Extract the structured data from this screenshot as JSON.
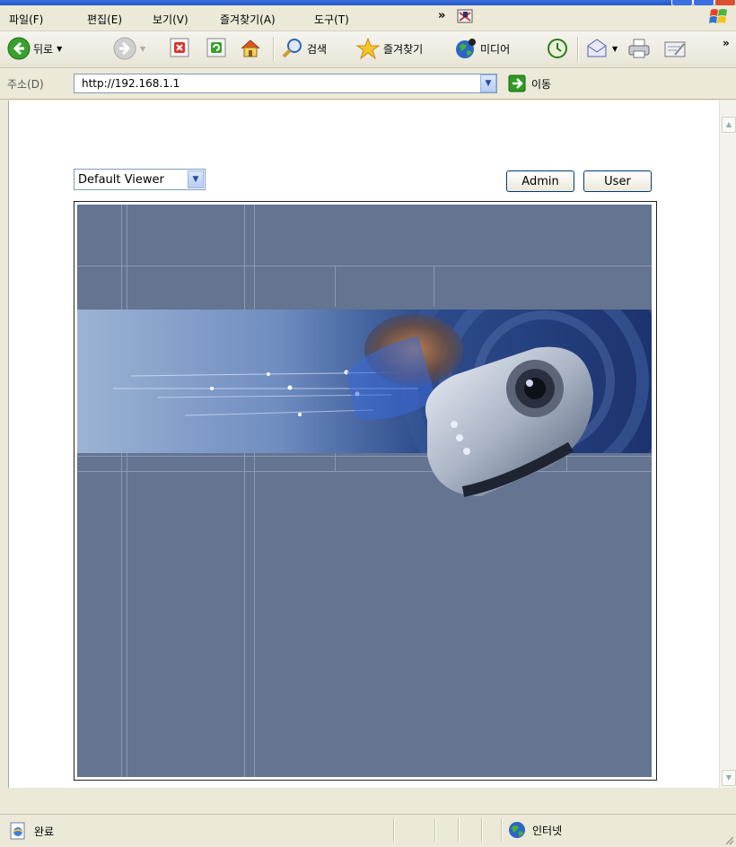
{
  "menu": {
    "items": [
      "파일(F)",
      "편집(E)",
      "보기(V)",
      "즐겨찾기(A)",
      "도구(T)"
    ],
    "more": "»"
  },
  "toolbar": {
    "back_label": "뒤로",
    "search_label": "검색",
    "favorites_label": "즐겨찾기",
    "media_label": "미디어",
    "more": "»"
  },
  "address": {
    "label": "주소(D)",
    "url": "http://192.168.1.1",
    "go_label": "이동"
  },
  "page": {
    "viewer_select": "Default Viewer",
    "admin_button": "Admin",
    "user_button": "User"
  },
  "status": {
    "text": "완료",
    "zone": "인터넷"
  },
  "colors": {
    "panel": "#647491",
    "panel_line": "#8c99b3",
    "chrome": "#ece9d8",
    "accent_blue": "#2358c9"
  }
}
